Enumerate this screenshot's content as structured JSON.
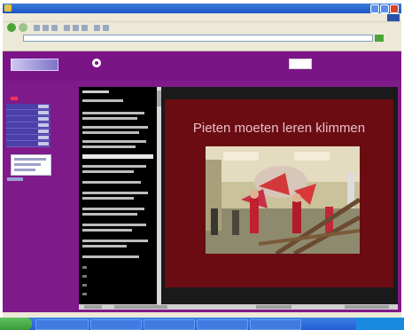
{
  "slide": {
    "title": "Pieten moeten leren klimmen"
  },
  "colors": {
    "page_background": "#7f1a8a",
    "slide_background": "#6b0c13",
    "slide_title": "#e8c0c4",
    "list_background": "#000000",
    "sidebar_row": "#4d3fa8"
  },
  "icons": {
    "speaker": "speaker-icon",
    "nav_back": "back-arrow-icon",
    "nav_forward": "forward-arrow-icon"
  }
}
